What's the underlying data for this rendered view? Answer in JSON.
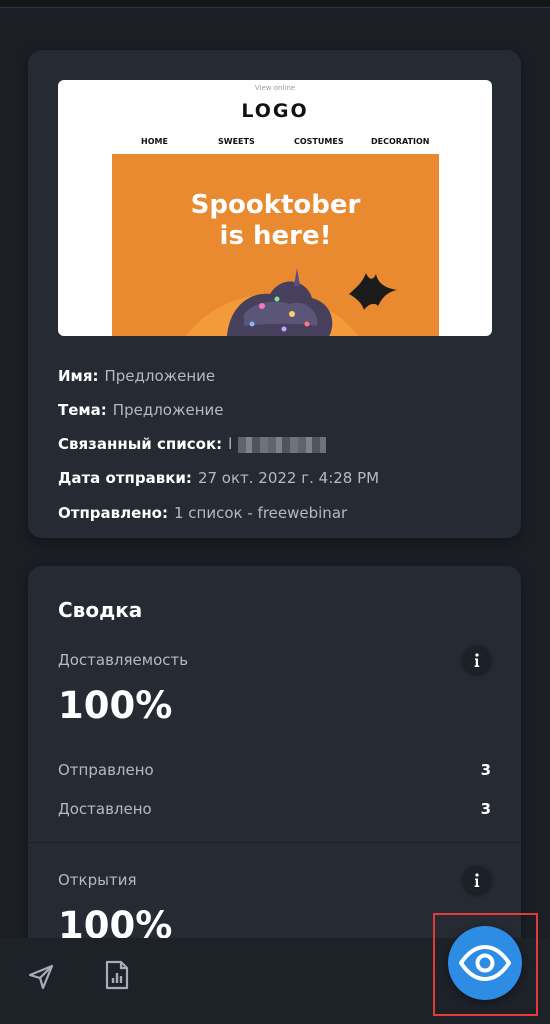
{
  "campaign": {
    "preview": {
      "view_online": "View online",
      "logo": "LOGO",
      "nav": [
        "HOME",
        "SWEETS",
        "COSTUMES",
        "DECORATION"
      ],
      "headline_line1": "Spooktober",
      "headline_line2": "is here!"
    },
    "name_label": "Имя:",
    "name_value": "Предложение",
    "subject_label": "Тема:",
    "subject_value": "Предложение",
    "list_label": "Связанный список:",
    "list_value": "l",
    "sent_date_label": "Дата отправки:",
    "sent_date_value": "27 окт. 2022 г. 4:28 PM",
    "sent_to_label": "Отправлено:",
    "sent_to_value": "1 список - freewebinar"
  },
  "summary": {
    "title": "Сводка",
    "deliverability": {
      "label": "Доставляемость",
      "percent": "100%",
      "rows": [
        {
          "label": "Отправлено",
          "value": "3"
        },
        {
          "label": "Доставлено",
          "value": "3"
        }
      ]
    },
    "opens": {
      "label": "Открытия",
      "percent": "100%"
    }
  },
  "icons": {
    "info": "info-icon",
    "send": "send-icon",
    "report": "report-icon",
    "eye": "eye-icon"
  },
  "colors": {
    "accent": "#2d8ce3",
    "highlight": "#e33b3b",
    "card": "#252a33",
    "banner": "#e98a30"
  }
}
